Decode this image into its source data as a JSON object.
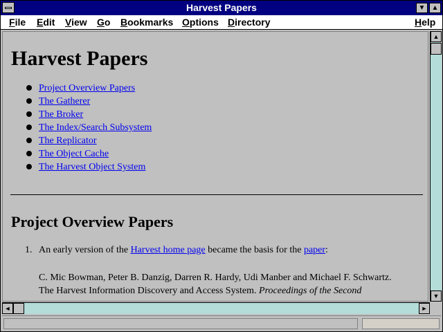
{
  "window": {
    "title": "Harvest Papers"
  },
  "title_controls": {
    "minimize_glyph": "▼",
    "maximize_glyph": "▲"
  },
  "menubar": {
    "items": [
      {
        "label": "File"
      },
      {
        "label": "Edit"
      },
      {
        "label": "View"
      },
      {
        "label": "Go"
      },
      {
        "label": "Bookmarks"
      },
      {
        "label": "Options"
      },
      {
        "label": "Directory"
      },
      {
        "label": "Help"
      }
    ]
  },
  "page": {
    "heading": "Harvest Papers",
    "toc": [
      "Project Overview Papers",
      "The Gatherer",
      "The Broker",
      "The Index/Search Subsystem",
      "The Replicator",
      "The Object Cache",
      "The Harvest Object System"
    ],
    "section_heading": "Project Overview Papers",
    "item1": {
      "number": "1.",
      "text_before": "An early version of the ",
      "link1": "Harvest home page",
      "text_mid": " became the basis for the ",
      "link2": "paper",
      "text_after": ":"
    },
    "reference": {
      "authors": "C. Mic Bowman, Peter B. Danzig, Darren R. Hardy, Udi Manber and Michael F. Schwartz.",
      "title": "The Harvest Information Discovery and Access System.",
      "venue": "Proceedings of the Second"
    }
  },
  "scrollbars": {
    "up_glyph": "▲",
    "down_glyph": "▼",
    "left_glyph": "◄",
    "right_glyph": "►"
  },
  "status": {
    "text": ""
  }
}
